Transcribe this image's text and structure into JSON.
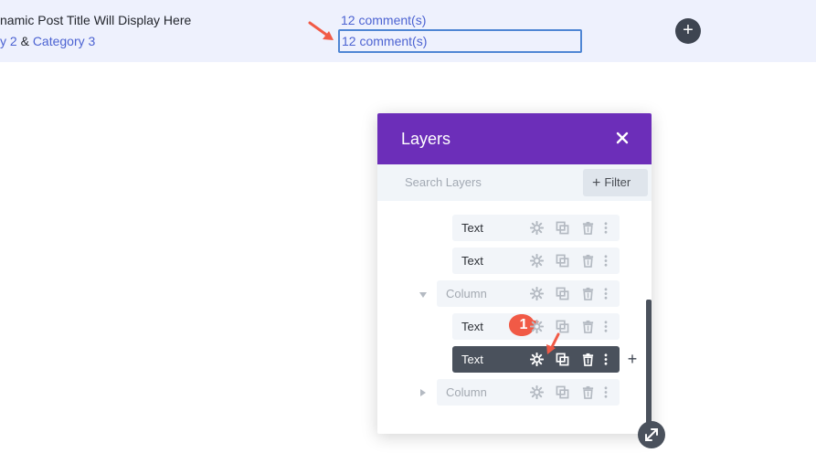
{
  "preview": {
    "post_title": "namic Post Title Will Display Here",
    "cats_prefix": "y 2",
    "cats_amp": " & ",
    "cats_cat3": "Category 3",
    "comments_link": "12 comment(s)",
    "comments_selected": "12 comment(s)",
    "add_icon": "plus-icon"
  },
  "layers": {
    "title": "Layers",
    "search_placeholder": "Search Layers",
    "filter_label": "Filter",
    "rows": [
      {
        "label": "Text",
        "type": "module"
      },
      {
        "label": "Text",
        "type": "module"
      },
      {
        "label": "Column",
        "type": "column",
        "expanded": true
      },
      {
        "label": "Text",
        "type": "module"
      },
      {
        "label": "Text",
        "type": "module",
        "active": true
      },
      {
        "label": "Column",
        "type": "column",
        "expanded": false
      }
    ],
    "row_actions": [
      "gear-icon",
      "duplicate-icon",
      "trash-icon",
      "more-icon"
    ]
  },
  "annotation": {
    "badge": "1"
  },
  "colors": {
    "header_purple": "#6c2eb9",
    "active_row": "#4a515c",
    "accent_red": "#f15a46",
    "link_blue": "#4c63d2",
    "strip_bg": "#eef1fd"
  }
}
